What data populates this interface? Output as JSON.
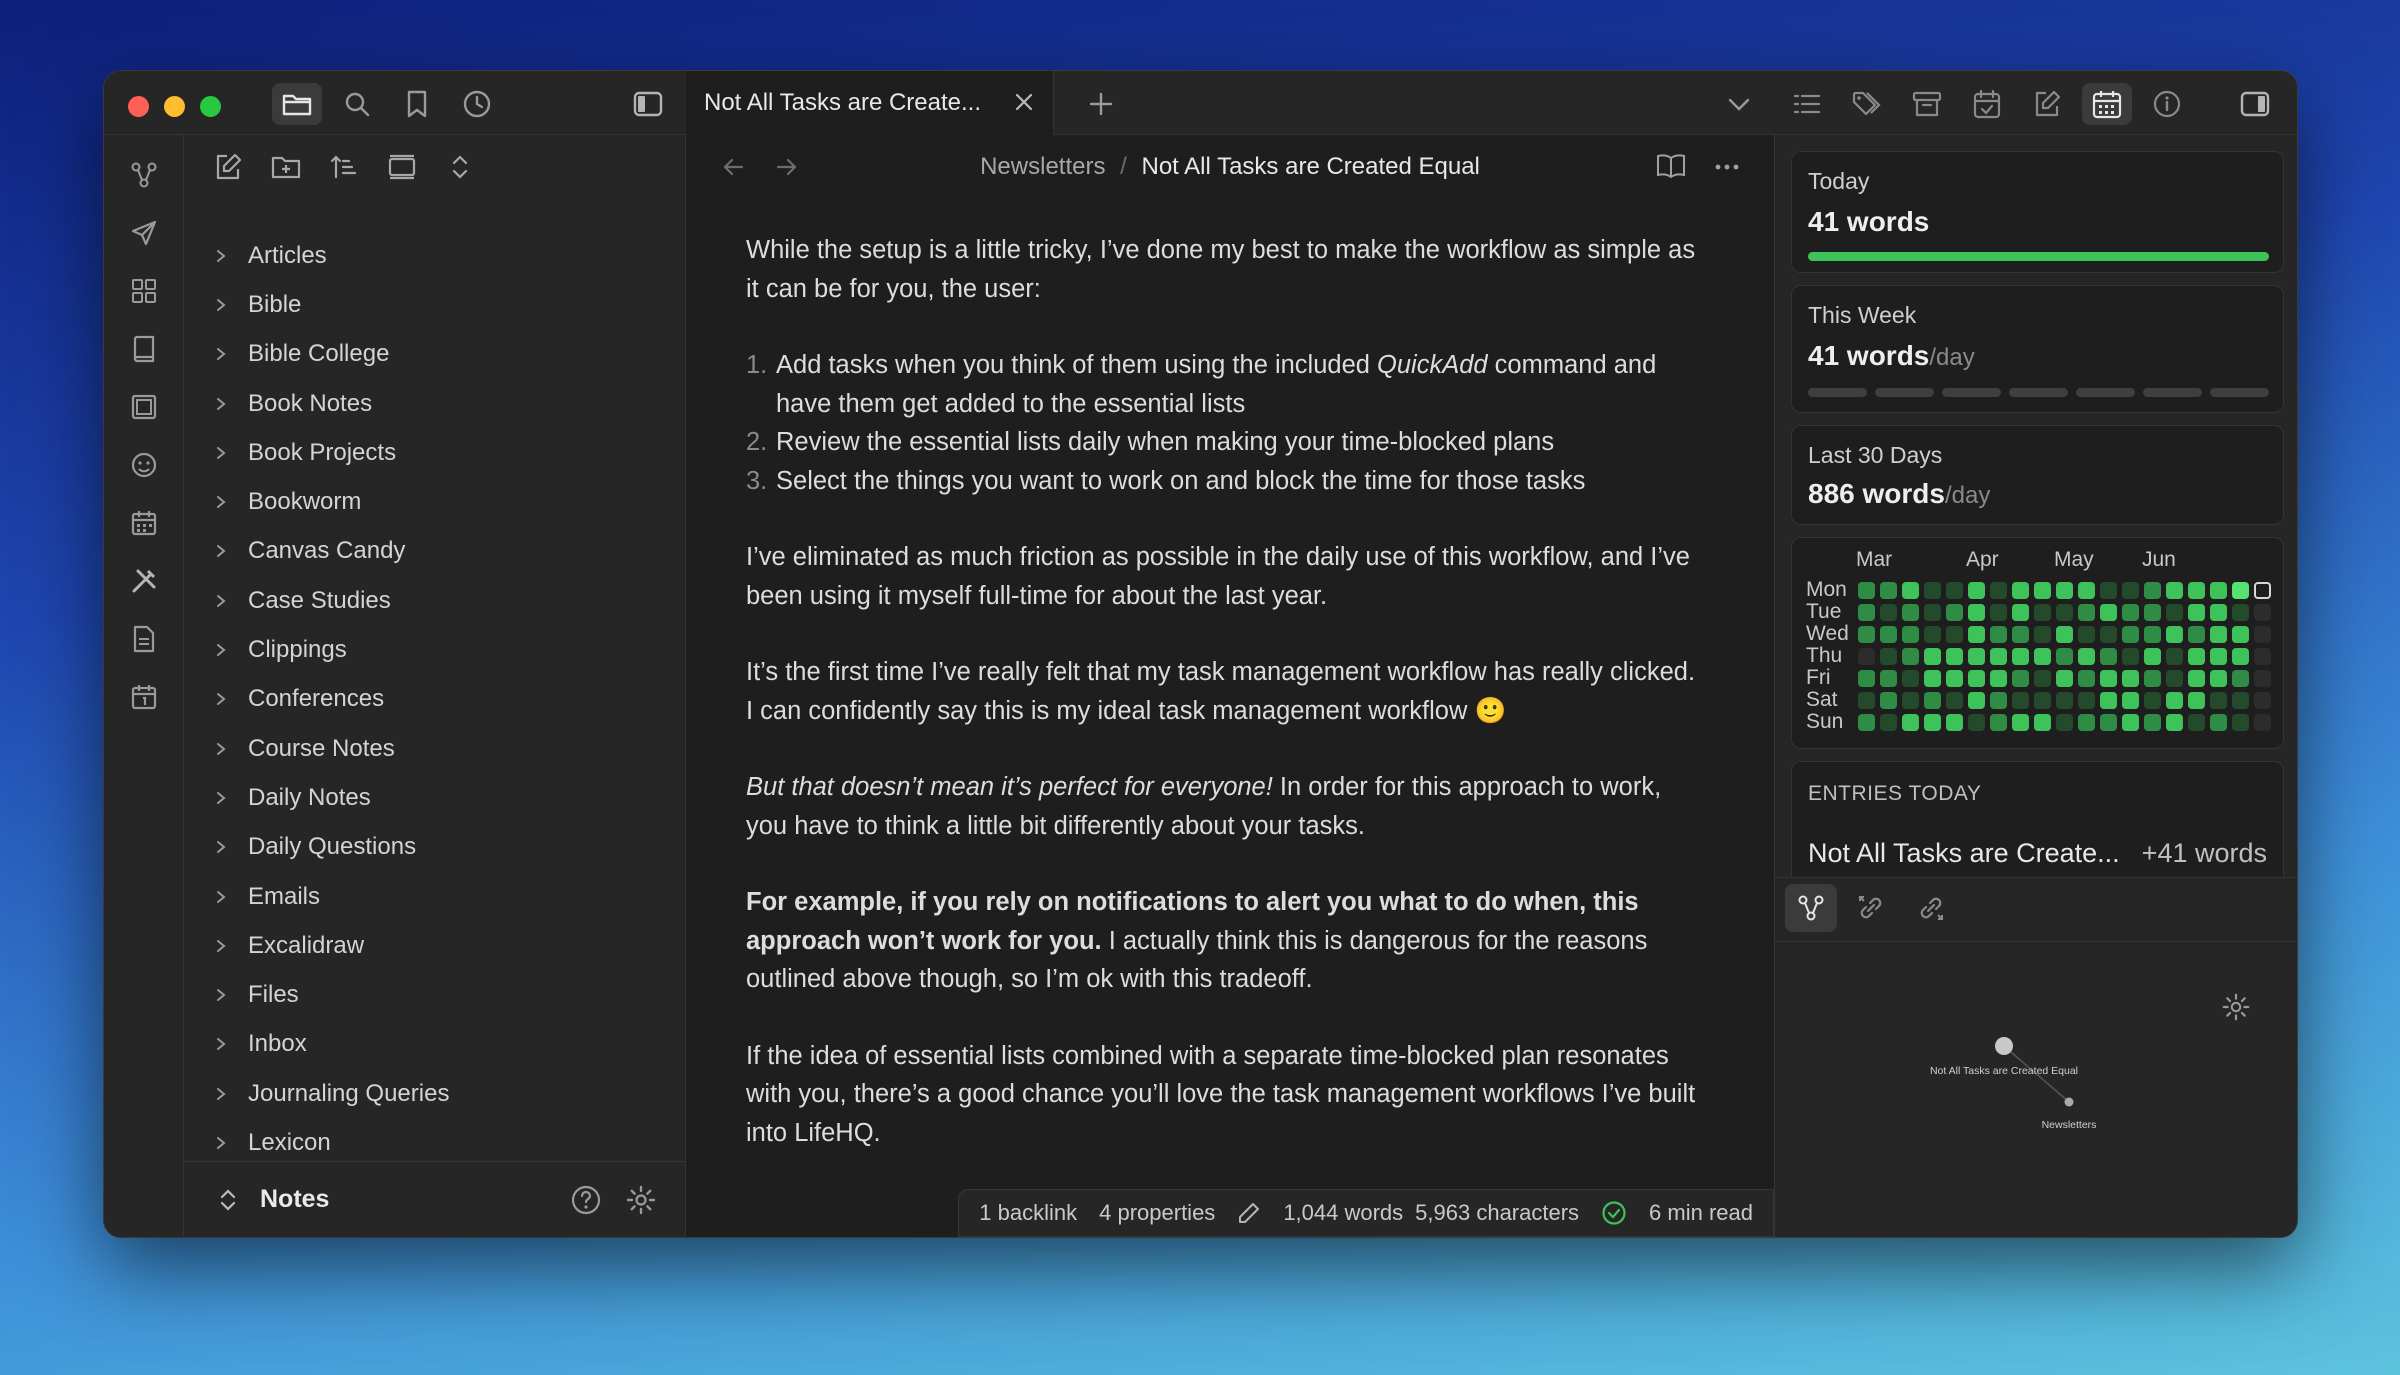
{
  "app": {
    "tab_title": "Not All Tasks are Create...",
    "traffic_colors": [
      "#fe5f57",
      "#febc2e",
      "#28c840"
    ]
  },
  "breadcrumb": {
    "folder": "Newsletters",
    "separator": "/",
    "note": "Not All Tasks are Created Equal"
  },
  "folders": [
    "Articles",
    "Bible",
    "Bible College",
    "Book Notes",
    "Book Projects",
    "Bookworm",
    "Canvas Candy",
    "Case Studies",
    "Clippings",
    "Conferences",
    "Course Notes",
    "Daily Notes",
    "Daily Questions",
    "Emails",
    "Excalidraw",
    "Files",
    "Inbox",
    "Journaling Queries",
    "Lexicon"
  ],
  "vault": {
    "name": "Notes"
  },
  "content": {
    "p1": "While the setup is a little tricky, I’ve done my best to make the workflow as simple as it can be for you, the user:",
    "list": [
      {
        "num": "1.",
        "pre": "Add tasks when you think of them using the included ",
        "em": "QuickAdd",
        "post": " command and have them get added to the essential lists"
      },
      {
        "num": "2.",
        "pre": "Review the essential lists daily when making your time-blocked plans",
        "em": "",
        "post": ""
      },
      {
        "num": "3.",
        "pre": "Select the things you want to work on and block the time for those tasks",
        "em": "",
        "post": ""
      }
    ],
    "p2": "I’ve eliminated as much friction as possible in the daily use of this workflow, and I’ve been using it myself full-time for about the last year.",
    "p3": "It’s the first time I’ve really felt that my task management workflow has really clicked. I can confidently say this is my ideal task management workflow 🙂",
    "p4_em": "But that doesn’t mean it’s perfect for everyone!",
    "p4_rest": " In order for this approach to work, you have to think a little bit differently about your tasks.",
    "p5_bold": "For example, if you rely on notifications to alert you what to do when, this approach won’t work for you.",
    "p5_rest": " I actually think this is dangerous for the reasons outlined above though, so I’m ok with this tradeoff.",
    "p6": "If the idea of essential lists combined with a separate time-blocked plan resonates with you, there’s a good chance you’ll love the task management workflows I’ve built into LifeHQ."
  },
  "status": {
    "backlinks": "1 backlink",
    "properties": "4 properties",
    "words": "1,044 words",
    "characters": "5,963 characters",
    "read": "6 min read"
  },
  "stats": {
    "today_label": "Today",
    "today_value": "41 words",
    "today_progress": 1.0,
    "week_label": "This Week",
    "week_value": "41 words",
    "week_unit": "/day",
    "month_label": "Last 30 Days",
    "month_value": "886 words",
    "month_unit": "/day",
    "accent": "#3ec35a"
  },
  "heatmap": {
    "months": [
      "Mar",
      "Apr",
      "May",
      "Jun"
    ],
    "days": [
      "Mon",
      "Tue",
      "Wed",
      "Thu",
      "Fri",
      "Sat",
      "Sun"
    ],
    "grid": [
      [
        2,
        2,
        3,
        1,
        1,
        3,
        1,
        3,
        3,
        3,
        3,
        1,
        1,
        2,
        3,
        3,
        3,
        4,
        9
      ],
      [
        2,
        1,
        2,
        1,
        2,
        3,
        1,
        3,
        1,
        1,
        2,
        3,
        2,
        2,
        1,
        3,
        3,
        1,
        0
      ],
      [
        2,
        2,
        2,
        1,
        1,
        3,
        2,
        2,
        1,
        3,
        1,
        1,
        2,
        2,
        3,
        2,
        3,
        3,
        0
      ],
      [
        0,
        1,
        2,
        3,
        3,
        3,
        3,
        3,
        3,
        2,
        3,
        2,
        1,
        3,
        1,
        3,
        3,
        3,
        0
      ],
      [
        2,
        2,
        1,
        3,
        3,
        3,
        3,
        2,
        1,
        3,
        2,
        3,
        3,
        2,
        1,
        3,
        3,
        2,
        0
      ],
      [
        1,
        2,
        1,
        2,
        1,
        3,
        2,
        1,
        1,
        1,
        1,
        3,
        3,
        1,
        3,
        3,
        1,
        1,
        0
      ],
      [
        2,
        1,
        3,
        3,
        3,
        1,
        2,
        3,
        3,
        1,
        2,
        2,
        3,
        2,
        3,
        1,
        2,
        1,
        0
      ]
    ],
    "levels": [
      "#2c2c2c",
      "#244a2c",
      "#2e8c44",
      "#3ec35a",
      "#56e273"
    ]
  },
  "entries": {
    "header": "ENTRIES TODAY",
    "items": [
      {
        "title": "Not All Tasks are Create...",
        "delta": "+41 words"
      }
    ]
  },
  "graph": {
    "node1": "Not All Tasks are Created Equal",
    "node2": "Newsletters"
  }
}
